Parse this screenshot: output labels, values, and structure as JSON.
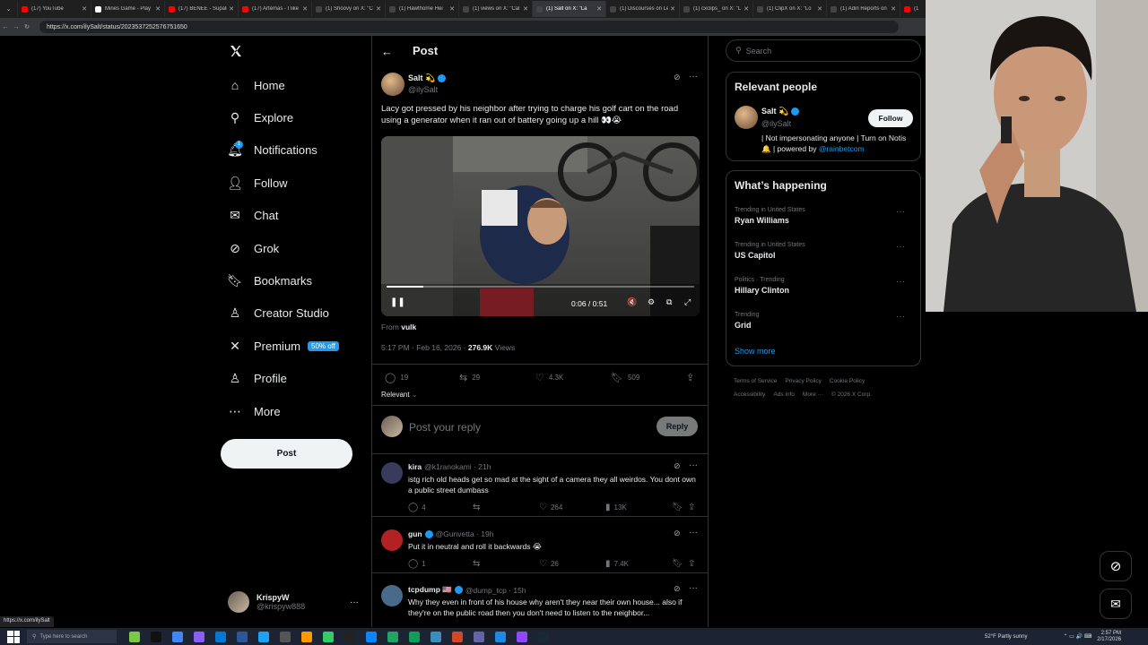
{
  "browser": {
    "tabs": [
      {
        "title": "(17) YouTube",
        "color": "#ff0000"
      },
      {
        "title": "Mines Game - Play",
        "color": "#ffffff"
      },
      {
        "title": "(17) BENEE - Supali",
        "color": "#ff0000"
      },
      {
        "title": "(17) Artemas - I like",
        "color": "#ff0000"
      },
      {
        "title": "(1) Shoovy on X: \"C",
        "color": "#444444"
      },
      {
        "title": "(1) Hawthorne Hei",
        "color": "#444444"
      },
      {
        "title": "(1) views on X: \"Cal",
        "color": "#444444"
      },
      {
        "title": "(1) Salt on X: \"La",
        "color": "#444444"
      },
      {
        "title": "(1) Discourses on Le",
        "color": "#444444"
      },
      {
        "title": "(1) cxclips_ on X: \"L",
        "color": "#444444"
      },
      {
        "title": "(1) ClipX on X: \"Lo",
        "color": "#444444"
      },
      {
        "title": "(1) Adin Reports on",
        "color": "#444444"
      },
      {
        "title": "(1",
        "color": "#ff0000"
      }
    ],
    "active_tab": 7,
    "url": "https://x.com/ilySalt/status/2023537252576751650",
    "status_url": "https://x.com/ilySalt"
  },
  "sidebar": {
    "items": [
      {
        "label": "Home",
        "icon": "home-icon"
      },
      {
        "label": "Explore",
        "icon": "search-icon"
      },
      {
        "label": "Notifications",
        "icon": "bell-icon",
        "badge": "1"
      },
      {
        "label": "Follow",
        "icon": "follow-icon"
      },
      {
        "label": "Chat",
        "icon": "mail-icon"
      },
      {
        "label": "Grok",
        "icon": "grok-icon"
      },
      {
        "label": "Bookmarks",
        "icon": "bookmark-icon"
      },
      {
        "label": "Creator Studio",
        "icon": "creator-icon"
      },
      {
        "label": "Premium",
        "icon": "x-logo-icon",
        "badge": "50% off"
      },
      {
        "label": "Profile",
        "icon": "profile-icon"
      },
      {
        "label": "More",
        "icon": "more-icon"
      }
    ],
    "post_label": "Post",
    "account": {
      "name": "KrispyW",
      "handle": "@krispyw888"
    }
  },
  "main": {
    "header_title": "Post",
    "post": {
      "author": "Salt 💫",
      "handle": "@ilySalt",
      "text": "Lacy got pressed by his neighbor after trying to charge his golf cart on the road using a generator when it ran out of battery going up a hill 👀😭",
      "video_time": "0:06 / 0:51",
      "video_progress": 0.12,
      "from_label": "From",
      "from_user": "vulk",
      "timestamp": "5:17 PM · Feb 16, 2026 ·",
      "views": "276.9K",
      "views_label": "Views",
      "replies": "19",
      "reposts": "29",
      "likes": "4.3K",
      "bookmarks": "509"
    },
    "relevant_label": "Relevant",
    "reply_placeholder": "Post your reply",
    "reply_button": "Reply",
    "replies": [
      {
        "name": "kira",
        "handle": "@k1ranokami · 21h",
        "text": "istg rich old heads get so mad at the sight of a camera they all weirdos. You dont own a public street dumbass",
        "replies": "4",
        "likes": "264",
        "views": "13K",
        "verified": false
      },
      {
        "name": "gun",
        "handle": "@Gunvetta · 19h",
        "text": "Put it in neutral and roll it backwards 😭",
        "replies": "1",
        "likes": "26",
        "views": "7.4K",
        "verified": true
      },
      {
        "name": "tcpdump 🇺🇸",
        "handle": "@dump_tcp · 15h",
        "text": "Why they even in front of his house why aren't they near their own house... also if they're on the public road then you don't need to listen to the neighbor...",
        "replies": "",
        "likes": "",
        "views": "",
        "verified": true
      }
    ]
  },
  "right": {
    "search_placeholder": "Search",
    "relevant_title": "Relevant people",
    "person": {
      "name": "Salt 💫",
      "handle": "@ilySalt",
      "bio": "| Not impersonating anyone | Turn on Notis 🔔 | powered by",
      "bio_link": "@rainbetcom",
      "follow": "Follow"
    },
    "happening_title": "What’s happening",
    "trends": [
      {
        "category": "Trending in United States",
        "name": "Ryan Williams"
      },
      {
        "category": "Trending in United States",
        "name": "US Capitol"
      },
      {
        "category": "Politics · Trending",
        "name": "Hillary Clinton"
      },
      {
        "category": "Trending",
        "name": "Grid"
      }
    ],
    "show_more": "Show more",
    "footer_line1": [
      "Terms of Service",
      "Privacy Policy",
      "Cookie Policy"
    ],
    "footer_line2": [
      "Accessibility",
      "Ads info",
      "More ···",
      "© 2026 X Corp."
    ]
  },
  "taskbar": {
    "search_placeholder": "Type here to search",
    "weather": "52°F  Partly sunny",
    "time": "2:57 PM",
    "date": "2/17/2026"
  },
  "colors": {
    "accent": "#1d9bf0",
    "background": "#000000",
    "border": "#2f3336",
    "muted": "#71767b"
  }
}
